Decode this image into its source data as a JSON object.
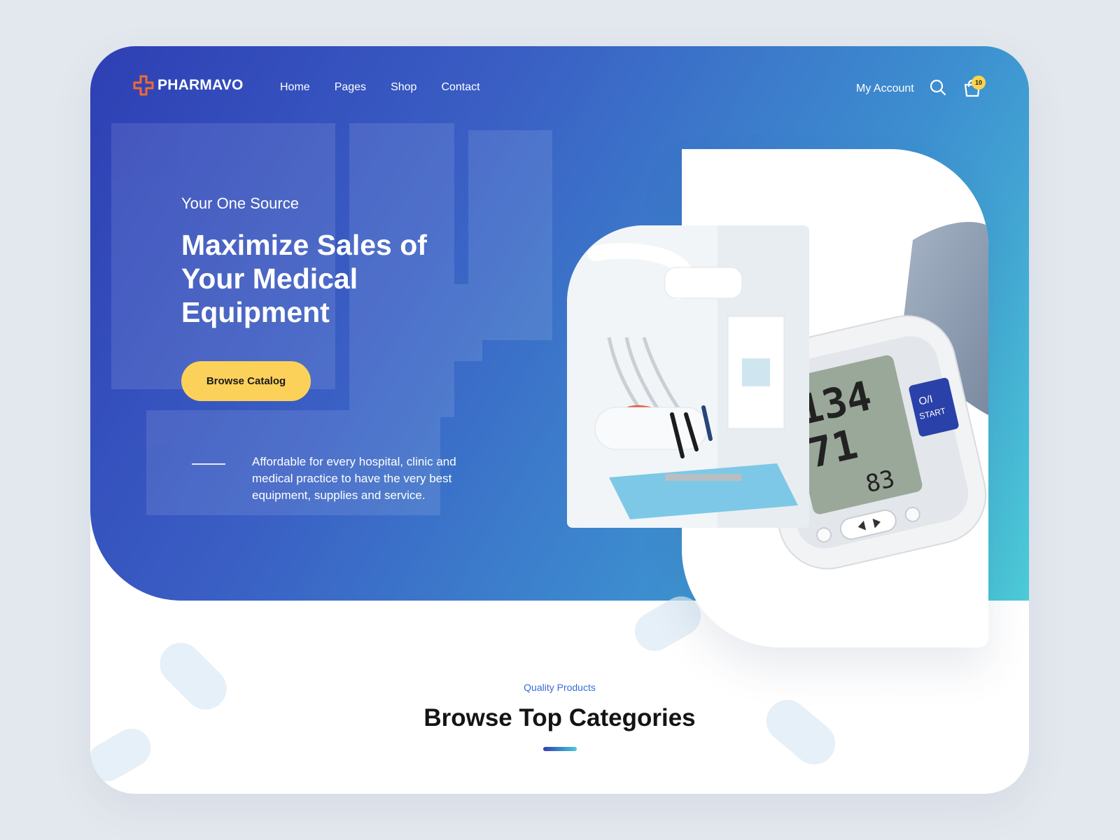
{
  "brand": {
    "name": "PHARMAVO",
    "icon": "cross-logo-icon"
  },
  "nav": {
    "items": [
      "Home",
      "Pages",
      "Shop",
      "Contact"
    ],
    "account_label": "My Account",
    "cart_count": "10"
  },
  "hero": {
    "eyebrow": "Your One Source",
    "headline": "Maximize Sales of Your Medical Equipment",
    "cta_label": "Browse Catalog",
    "description": "Affordable for every hospital, clinic and medical practice to have the very best equipment, supplies and service."
  },
  "device": {
    "sys": "134",
    "dia": "71",
    "pulse": "83",
    "button_label": "O/I",
    "button_sub": "START"
  },
  "section": {
    "kicker": "Quality Products",
    "title": "Browse Top Categories"
  },
  "colors": {
    "accent": "#fcd15a",
    "brand_blue": "#2e3fb4",
    "brand_teal": "#4ccbd8",
    "logo_orange": "#f26a2e"
  }
}
